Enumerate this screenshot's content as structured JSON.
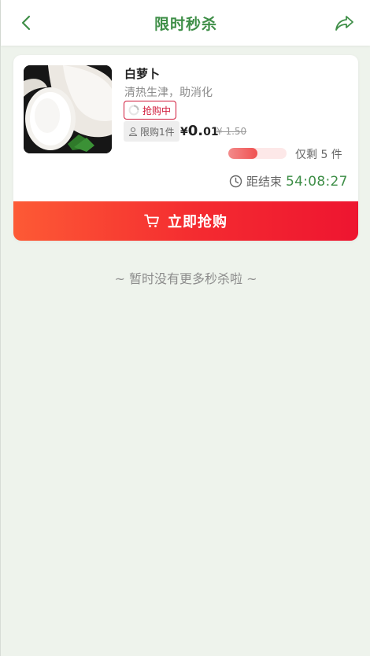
{
  "header": {
    "title": "限时秒杀",
    "back_icon": "chevron-left-icon",
    "share_icon": "share-icon"
  },
  "colors": {
    "accent_green": "#3e8e47",
    "accent_red": "#d0193a",
    "button_gradient_start": "#fd5a35",
    "button_gradient_end": "#ee1530",
    "page_bg": "#eef3ec"
  },
  "item": {
    "name": "白萝卜",
    "description": "清热生津，助消化",
    "status": "抢购中",
    "limit": "限购1件",
    "price_symbol": "¥",
    "price_int": "0.",
    "price_dec": "01",
    "original_price": "¥ 1.50",
    "stock_progress": 0.5,
    "stock_text": "仅剩 5 件",
    "countdown_label": "距结束",
    "countdown_time": "54:08:27",
    "buy_label": "立即抢购"
  },
  "footer_note": "~ 暂时没有更多秒杀啦 ~"
}
